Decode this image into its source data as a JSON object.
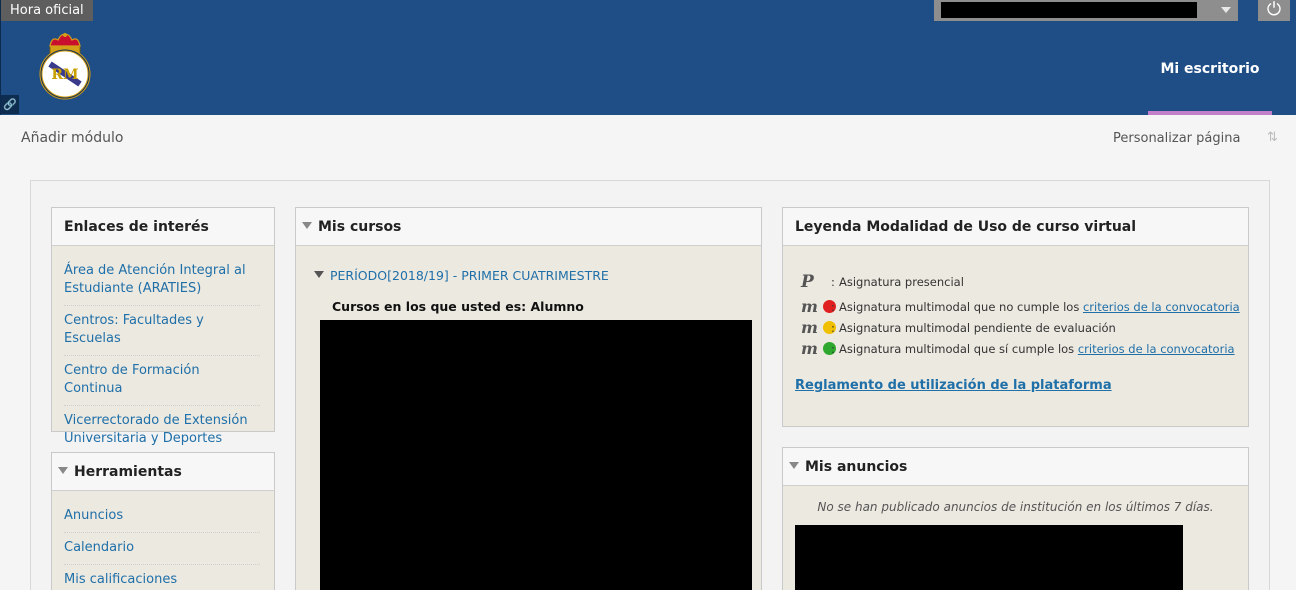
{
  "header": {
    "hora_oficial": "Hora oficial",
    "nav_active": "Mi escritorio",
    "logout_glyph": "⏻",
    "link_glyph": "🔗"
  },
  "toolbar": {
    "add_module": "Añadir módulo",
    "personalize": "Personalizar página",
    "reorder_glyph": "⇅"
  },
  "enlaces": {
    "title": "Enlaces de interés",
    "items": [
      "Área de Atención Integral al Estudiante (ARATIES)",
      "Centros: Facultades y Escuelas",
      "Centro de Formación Continua",
      "Vicerrectorado de Extensión Universitaria y Deportes"
    ]
  },
  "herramientas": {
    "title": "Herramientas",
    "items": [
      "Anuncios",
      "Calendario",
      "Mis calificaciones"
    ]
  },
  "mis_cursos": {
    "title": "Mis cursos",
    "period": "PERÍODO[2018/19] - PRIMER CUATRIMESTRE",
    "role_heading": "Cursos en los que usted es: Alumno"
  },
  "leyenda": {
    "title": "Leyenda Modalidad de Uso de curso virtual",
    "rows": [
      {
        "icon": "presencial-icon",
        "text": "Asignatura presencial",
        "link": ""
      },
      {
        "icon": "multimodal-red-icon",
        "text": "Asignatura multimodal que no cumple los ",
        "link": "criterios de la convocatoria",
        "dot": "#e02020"
      },
      {
        "icon": "multimodal-yellow-icon",
        "text": "Asignatura multimodal pendiente de evaluación",
        "link": "",
        "dot": "#f0c000"
      },
      {
        "icon": "multimodal-green-icon",
        "text": "Asignatura multimodal que sí cumple los ",
        "link": "criterios de la convocatoria",
        "dot": "#2ea82e"
      }
    ],
    "regulation_link": "Reglamento de utilización de la plataforma"
  },
  "anuncios": {
    "title": "Mis anuncios",
    "empty_message": "No se han publicado anuncios de institución en los últimos 7 días."
  },
  "colors": {
    "header_bg": "#1f4e86",
    "accent_underline": "#c17ec9",
    "link": "#1f6fa8"
  }
}
